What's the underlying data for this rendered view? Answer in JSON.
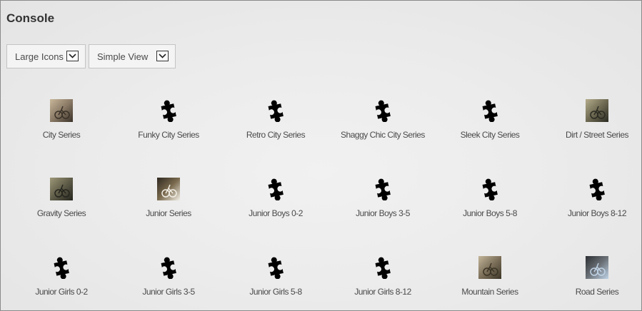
{
  "page": {
    "title": "Console"
  },
  "toolbar": {
    "view_select": {
      "value": "Large Icons",
      "icon": "chevron-down-icon"
    },
    "mode_select": {
      "value": "Simple View",
      "icon": "chevron-down-icon"
    }
  },
  "items": [
    {
      "label": "City Series",
      "icon": "photo",
      "palette": [
        "#3a3228",
        "#8a7a66",
        "#c9b79a"
      ]
    },
    {
      "label": "Funky City Series",
      "icon": "puzzle-icon"
    },
    {
      "label": "Retro City Series",
      "icon": "puzzle-icon"
    },
    {
      "label": "Shaggy Chic City Series",
      "icon": "puzzle-icon"
    },
    {
      "label": "Sleek City Series",
      "icon": "puzzle-icon"
    },
    {
      "label": "Dirt / Street Series",
      "icon": "photo",
      "palette": [
        "#2b2b22",
        "#6e6a52",
        "#b5ad8c"
      ]
    },
    {
      "label": "Gravity Series",
      "icon": "photo",
      "palette": [
        "#25251e",
        "#5f5c48",
        "#9e9878"
      ]
    },
    {
      "label": "Junior Series",
      "icon": "photo",
      "palette": [
        "#f3efe6",
        "#7a6a4e",
        "#2e2820"
      ]
    },
    {
      "label": "Junior Boys 0-2",
      "icon": "puzzle-icon"
    },
    {
      "label": "Junior Boys 3-5",
      "icon": "puzzle-icon"
    },
    {
      "label": "Junior Boys 5-8",
      "icon": "puzzle-icon"
    },
    {
      "label": "Junior Boys 8-12",
      "icon": "puzzle-icon"
    },
    {
      "label": "Junior Girls 0-2",
      "icon": "puzzle-icon"
    },
    {
      "label": "Junior Girls 3-5",
      "icon": "puzzle-icon"
    },
    {
      "label": "Junior Girls 5-8",
      "icon": "puzzle-icon"
    },
    {
      "label": "Junior Girls 8-12",
      "icon": "puzzle-icon"
    },
    {
      "label": "Mountain Series",
      "icon": "photo",
      "palette": [
        "#3b3426",
        "#7d705a",
        "#c2b599"
      ]
    },
    {
      "label": "Road Series",
      "icon": "photo",
      "palette": [
        "#bfd3e6",
        "#6a7076",
        "#2c2f33"
      ]
    }
  ]
}
